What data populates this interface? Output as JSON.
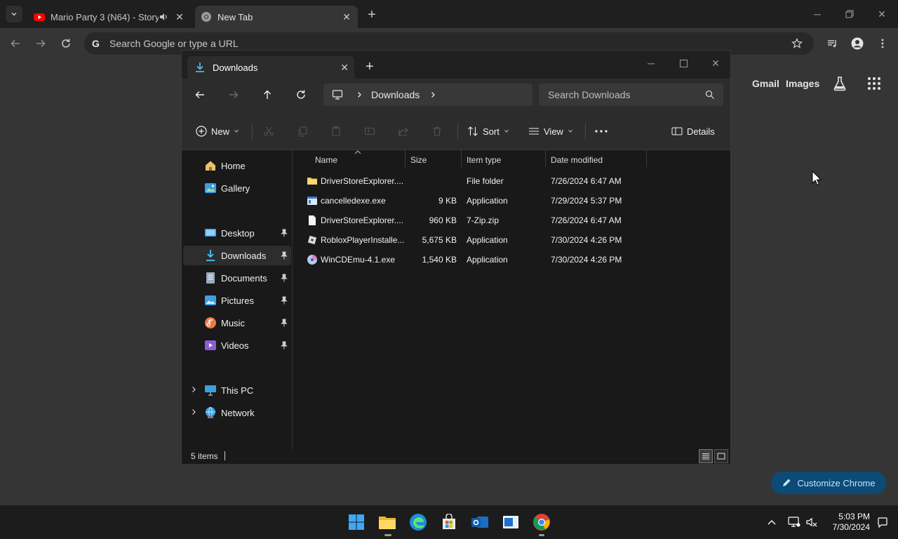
{
  "browser": {
    "tabs": [
      {
        "title": "Mario Party 3 (N64) - Story",
        "favicon": "youtube-icon",
        "audio": true,
        "active": false
      },
      {
        "title": "New Tab",
        "favicon": "chrome-icon",
        "active": true
      }
    ],
    "omnibox_placeholder": "Search Google or type a URL",
    "ntp_links": {
      "gmail": "Gmail",
      "images": "Images"
    },
    "customize_label": "Customize Chrome"
  },
  "explorer": {
    "tab_title": "Downloads",
    "breadcrumb": [
      "Downloads"
    ],
    "search_placeholder": "Search Downloads",
    "commands": {
      "new": "New",
      "sort": "Sort",
      "view": "View",
      "details": "Details"
    },
    "nav": {
      "home": "Home",
      "gallery": "Gallery",
      "desktop": "Desktop",
      "downloads": "Downloads",
      "documents": "Documents",
      "pictures": "Pictures",
      "music": "Music",
      "videos": "Videos",
      "this_pc": "This PC",
      "network": "Network"
    },
    "columns": {
      "name": "Name",
      "size": "Size",
      "type": "Item type",
      "date": "Date modified"
    },
    "files": [
      {
        "name": "DriverStoreExplorer....",
        "size": "",
        "type": "File folder",
        "date": "7/26/2024 6:47 AM",
        "icon": "folder-icon"
      },
      {
        "name": "cancelledexe.exe",
        "size": "9 KB",
        "type": "Application",
        "date": "7/29/2024 5:37 PM",
        "icon": "exe-icon"
      },
      {
        "name": "DriverStoreExplorer....",
        "size": "960 KB",
        "type": "7-Zip.zip",
        "date": "7/26/2024 6:47 AM",
        "icon": "file-icon"
      },
      {
        "name": "RobloxPlayerInstalle...",
        "size": "5,675 KB",
        "type": "Application",
        "date": "7/30/2024 4:26 PM",
        "icon": "roblox-icon"
      },
      {
        "name": "WinCDEmu-4.1.exe",
        "size": "1,540 KB",
        "type": "Application",
        "date": "7/30/2024 4:26 PM",
        "icon": "wincdemu-icon"
      }
    ],
    "status_count": "5 items"
  },
  "taskbar": {
    "time": "5:03 PM",
    "date": "7/30/2024"
  }
}
